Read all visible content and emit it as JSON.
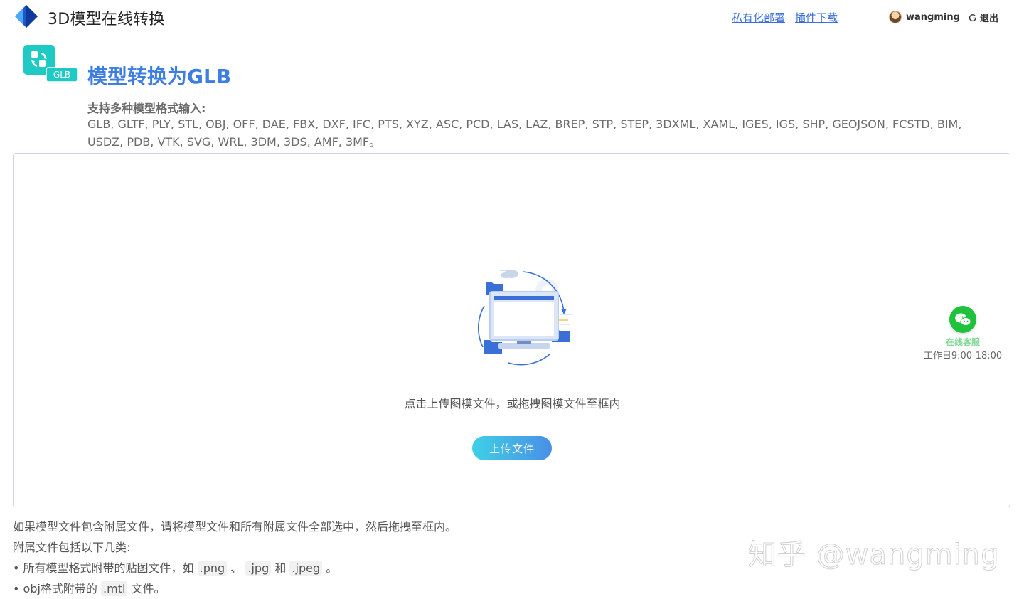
{
  "header": {
    "app_title": "3D模型在线转换",
    "links": [
      "私有化部署",
      "插件下载"
    ],
    "username": "wangming",
    "logout_label": "退出"
  },
  "hero": {
    "icon_badge": "GLB",
    "title": "模型转换为GLB",
    "support_label": "支持多种模型格式输入:",
    "support_formats": "GLB, GLTF, PLY, STL, OBJ, OFF, DAE, FBX, DXF, IFC, PTS, XYZ, ASC, PCD, LAS, LAZ, BREP, STP, STEP, 3DXML, XAML, IGES, IGS, SHP, GEOJSON, FCSTD, BIM, USDZ, PDB, VTK, SVG, WRL, 3DM, 3DS, AMF, 3MF。"
  },
  "dropzone": {
    "hint": "点击上传图模文件，或拖拽图模文件至框内",
    "upload_label": "上传文件"
  },
  "service": {
    "label": "在线客服",
    "hours": "工作日9:00-18:00"
  },
  "notes": {
    "line1": "如果模型文件包含附属文件，请将模型文件和所有附属文件全部选中，然后拖拽至框内。",
    "line2": "附属文件包括以下几类:",
    "line3_prefix": "• 所有模型格式附带的贴图文件，如",
    "ext_png": ".png",
    "sep1": "、",
    "ext_jpg": ".jpg",
    "and": "和",
    "ext_jpeg": ".jpeg",
    "end": "。",
    "line4_prefix": "• obj格式附带的",
    "ext_mtl": ".mtl",
    "line4_suffix": "文件。"
  },
  "watermark": "知乎 @wangming",
  "colors": {
    "accent": "#3d7ee0",
    "link": "#3a6fd8",
    "wechat": "#1fc23c",
    "teal": "#1fc9c4"
  }
}
